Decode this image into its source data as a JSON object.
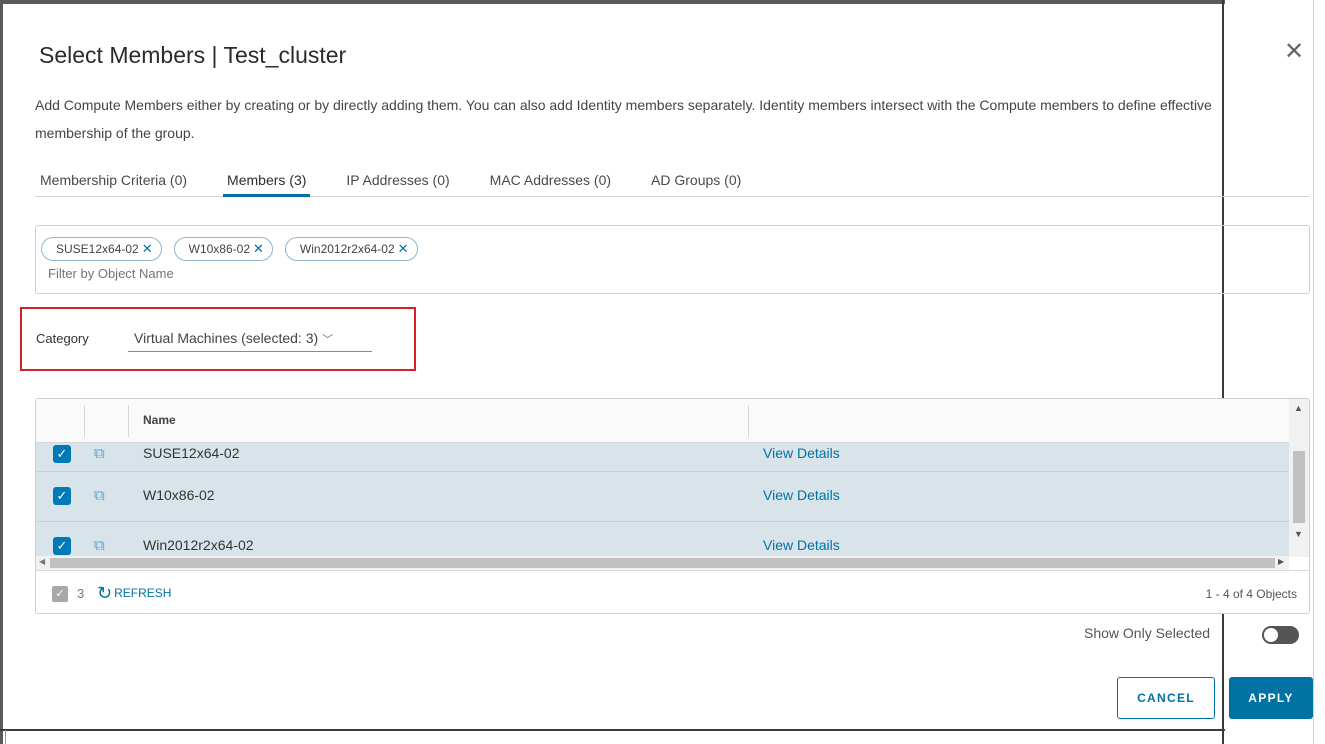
{
  "dialog": {
    "title": "Select Members | Test_cluster",
    "description": "Add Compute Members either by creating or by directly adding them. You can also add Identity members separately. Identity members intersect with the Compute members to define effective membership of the group."
  },
  "tabs": [
    {
      "label": "Membership Criteria (0)",
      "active": false
    },
    {
      "label": "Members (3)",
      "active": true
    },
    {
      "label": "IP Addresses (0)",
      "active": false
    },
    {
      "label": "MAC Addresses (0)",
      "active": false
    },
    {
      "label": "AD Groups (0)",
      "active": false
    }
  ],
  "filter": {
    "chips": [
      "SUSE12x64-02",
      "W10x86-02",
      "Win2012r2x64-02"
    ],
    "placeholder": "Filter by Object Name"
  },
  "category": {
    "label": "Category",
    "selected": "Virtual Machines (selected: 3)"
  },
  "grid": {
    "columns": [
      "Name",
      ""
    ],
    "rows": [
      {
        "name": "SUSE12x64-02",
        "link": "View Details",
        "checked": true
      },
      {
        "name": "W10x86-02",
        "link": "View Details",
        "checked": true
      },
      {
        "name": "Win2012r2x64-02",
        "link": "View Details",
        "checked": true
      }
    ],
    "footer": {
      "selected_count": "3",
      "refresh_label": "REFRESH",
      "pagination": "1 - 4 of 4 Objects"
    }
  },
  "show_only_selected": {
    "label": "Show Only Selected",
    "on": false
  },
  "buttons": {
    "cancel": "CANCEL",
    "apply": "APPLY"
  },
  "colors": {
    "accent": "#0072a3",
    "checkbox": "#0079b8",
    "selected_row": "#d9e4ea",
    "highlight_border": "#d61f26"
  }
}
